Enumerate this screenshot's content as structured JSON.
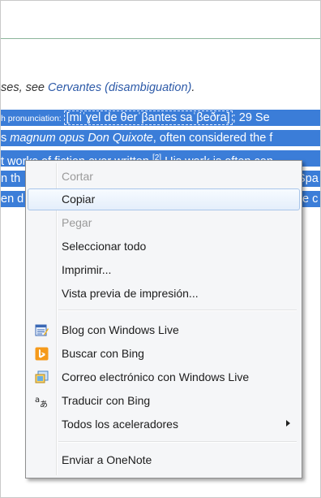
{
  "article": {
    "hatnote_prefix": "ses, see ",
    "hatnote_link": "Cervantes (disambiguation)",
    "hatnote_suffix": ".",
    "line1_small": "h pronunciation: ",
    "line1_ipa": "[miˈɣel de θerˈβantes saˈβeðra]",
    "line1_rest": "; 29 Se",
    "line2_a": "s ",
    "line2_b": "magnum opus Don Quixote",
    "line2_c": ", often considered the f",
    "line3_a": "t works of fiction ever written.",
    "line3_sup": "[2]",
    "line3_c": " His work is often con",
    "line4_a": "n th",
    "line4_b": "Spa",
    "line5_a": "en d",
    "line5_b": "e c"
  },
  "context_menu": {
    "items": [
      {
        "label": "Cortar",
        "enabled": false
      },
      {
        "label": "Copiar",
        "enabled": true,
        "highlighted": true
      },
      {
        "label": "Pegar",
        "enabled": false
      },
      {
        "label": "Seleccionar todo",
        "enabled": true
      },
      {
        "label": "Imprimir...",
        "enabled": true
      },
      {
        "label": "Vista previa de impresión...",
        "enabled": true
      },
      {
        "label": "Blog con Windows Live",
        "icon": "blog-icon"
      },
      {
        "label": "Buscar con Bing",
        "icon": "bing-icon"
      },
      {
        "label": "Correo electrónico con Windows Live",
        "icon": "mail-icon"
      },
      {
        "label": "Traducir con Bing",
        "icon": "translate-icon"
      },
      {
        "label": "Todos los aceleradores",
        "submenu": true
      },
      {
        "label": "Enviar a OneNote"
      }
    ]
  },
  "colors": {
    "selection": "#3b7dd8",
    "link": "#2d5aa8",
    "menu_bg": "#f5f6f8",
    "bing": "#f59a1b"
  }
}
